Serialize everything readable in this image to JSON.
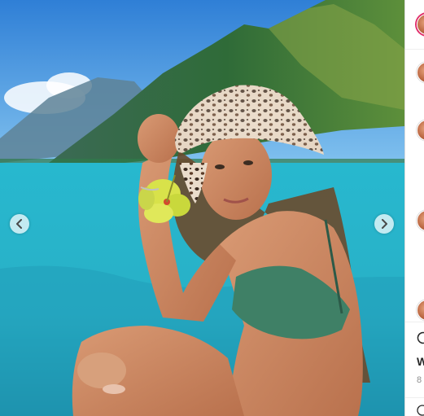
{
  "post": {
    "image_description_icon": "photo",
    "prev_control": "chevron-left-icon",
    "next_control": "chevron-right-icon"
  },
  "sidebar": {
    "partial_like_text": "W",
    "partial_time_text": "8",
    "comment_icon": "comment-icon",
    "emoji_icon": "emoji-icon"
  },
  "colors": {
    "divider": "#dbdbdb",
    "story_ring": "#e1306c",
    "muted_text": "#8e8e8e"
  }
}
